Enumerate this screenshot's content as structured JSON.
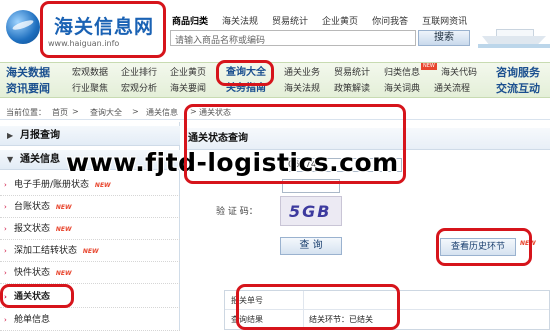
{
  "logo": {
    "title": "海关信息网",
    "url": "www.haiguan.info"
  },
  "category_bar": {
    "heading": "商品归类",
    "links": [
      "海关法规",
      "贸易统计",
      "企业黄页",
      "你问我答",
      "互联网资讯"
    ]
  },
  "search": {
    "placeholder": "请输入商品名称或编码",
    "button_label": "搜索"
  },
  "nav": {
    "row1": {
      "heading": "海关数据",
      "items": [
        "宏观数据",
        "企业排行",
        "企业黄页"
      ],
      "active": "查询大全",
      "items2": [
        "通关业务",
        "贸易统计",
        "归类信息",
        "海关代码"
      ],
      "new_badge": "NEW",
      "right": "咨询服务"
    },
    "row2": {
      "heading": "资讯要闻",
      "items": [
        "行业聚焦",
        "宏观分析",
        "海关要闻"
      ],
      "active": "关务指南",
      "items2": [
        "海关法规",
        "政策解读",
        "海关词典",
        "通关流程"
      ],
      "right": "交流互动"
    }
  },
  "breadcrumb": {
    "prefix": "当前位置：",
    "items": [
      "首页",
      "查询大全",
      "通关信息"
    ],
    "current": "通关状态"
  },
  "sidebar": {
    "monthly": "月报查询",
    "section": "通关信息",
    "new_label": "NEW",
    "items": [
      {
        "label": "电子手册/账册状态",
        "new": true
      },
      {
        "label": "台账状态",
        "new": true
      },
      {
        "label": "报文状态",
        "new": true
      },
      {
        "label": "深加工结转状态",
        "new": true
      },
      {
        "label": "快件状态",
        "new": true
      },
      {
        "label": "通关状态",
        "new": false
      },
      {
        "label": "舱单信息",
        "new": false
      }
    ]
  },
  "main": {
    "title": "通关状态查询",
    "partial_number": "06774",
    "captcha_label": "验  证  码：",
    "captcha_text": "5GB",
    "query_button": "查  询",
    "history_button": "查看历史环节",
    "history_new": "NEW",
    "result": {
      "row1_label": "报关单号",
      "row1_value": "",
      "row2_label": "查询结果",
      "row2_value": "结关环节：已结关"
    }
  },
  "watermark": "www.fjtd-logistics.com",
  "colors": {
    "highlight": "#d6141b",
    "nav_text": "#1a4f8f",
    "new_badge": "#e8462e"
  }
}
